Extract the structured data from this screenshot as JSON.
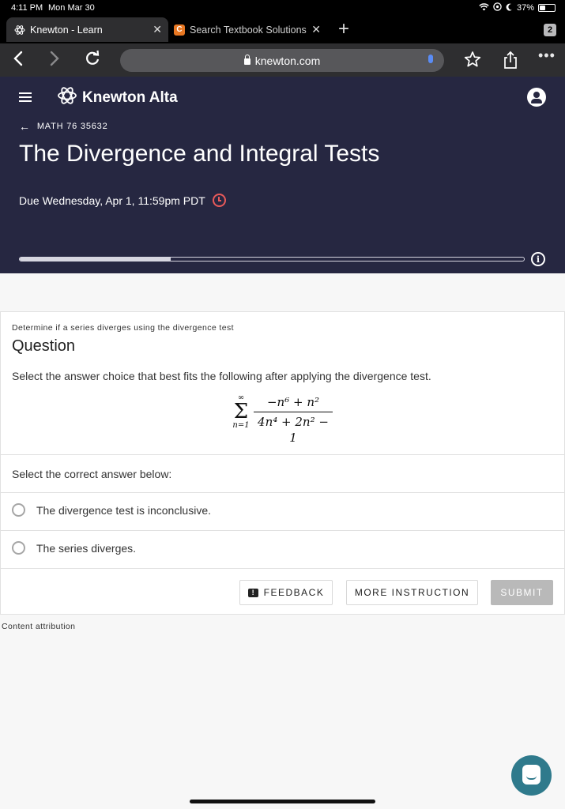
{
  "status_bar": {
    "time": "4:11 PM",
    "date": "Mon Mar 30",
    "battery_text": "37%",
    "battery_level": 0.37
  },
  "browser": {
    "tabs": [
      {
        "label": "Knewton - Learn",
        "active": true,
        "icon": "knewton-atom-icon"
      },
      {
        "label": "Search Textbook Solutions",
        "active": false,
        "icon": "chegg-c-icon"
      }
    ],
    "tab_count": "2",
    "url": "knewton.com",
    "colors": {
      "chrome_bg": "#000000",
      "toolbar_bg": "#2e2e30",
      "url_bg": "#57575a"
    }
  },
  "header": {
    "brand": "Knewton Alta",
    "course": "MATH 76 35632",
    "assignment_title": "The Divergence and Integral Tests",
    "due": "Due Wednesday, Apr 1, 11:59pm PDT",
    "progress_fraction": 0.3,
    "colors": {
      "background": "#262741",
      "clock": "#e85a5a"
    }
  },
  "question": {
    "objective": "Determine if a series diverges using the divergence test",
    "heading": "Question",
    "prompt": "Select the answer choice that best fits the following after applying the divergence test.",
    "formula": {
      "sum_upper": "∞",
      "sum_symbol": "Σ",
      "sum_lower": "n=1",
      "numerator": "−n⁶ + n²",
      "denominator": "4n⁴ + 2n² − 1"
    },
    "select_label": "Select the correct answer below:",
    "options": [
      "The divergence test is inconclusive.",
      "The series diverges."
    ]
  },
  "actions": {
    "feedback": "FEEDBACK",
    "more_instruction": "MORE INSTRUCTION",
    "submit": "SUBMIT"
  },
  "footer": {
    "attribution": "Content attribution"
  }
}
